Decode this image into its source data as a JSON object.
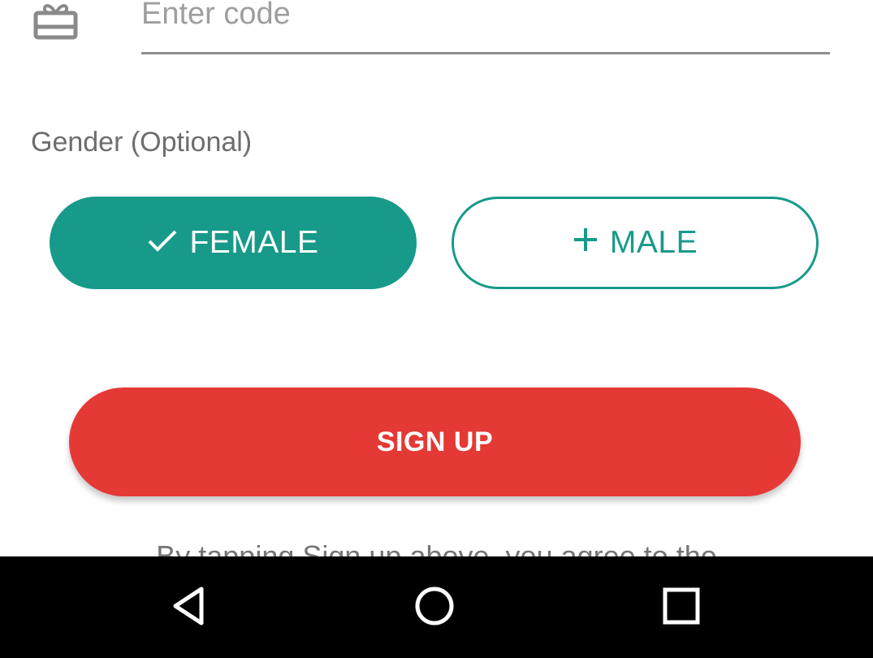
{
  "referral": {
    "icon": "gift-card-icon",
    "placeholder": "Enter code",
    "value": ""
  },
  "gender": {
    "label": "Gender (Optional)",
    "options": [
      {
        "label": "FEMALE",
        "selected": true,
        "icon": "check-icon"
      },
      {
        "label": "MALE",
        "selected": false,
        "icon": "plus-icon"
      }
    ]
  },
  "signup": {
    "label": "SIGN UP"
  },
  "terms": {
    "text": "By tapping Sign up above, you agree to the"
  },
  "nav": {
    "back_icon": "back-triangle-icon",
    "home_icon": "home-circle-icon",
    "recents_icon": "recents-square-icon"
  },
  "colors": {
    "accent_teal": "#179a8a",
    "signup_red": "#e53935",
    "nav_bar": "#000000",
    "label_gray": "#6d6d6d",
    "placeholder_gray": "#9e9e9e"
  }
}
